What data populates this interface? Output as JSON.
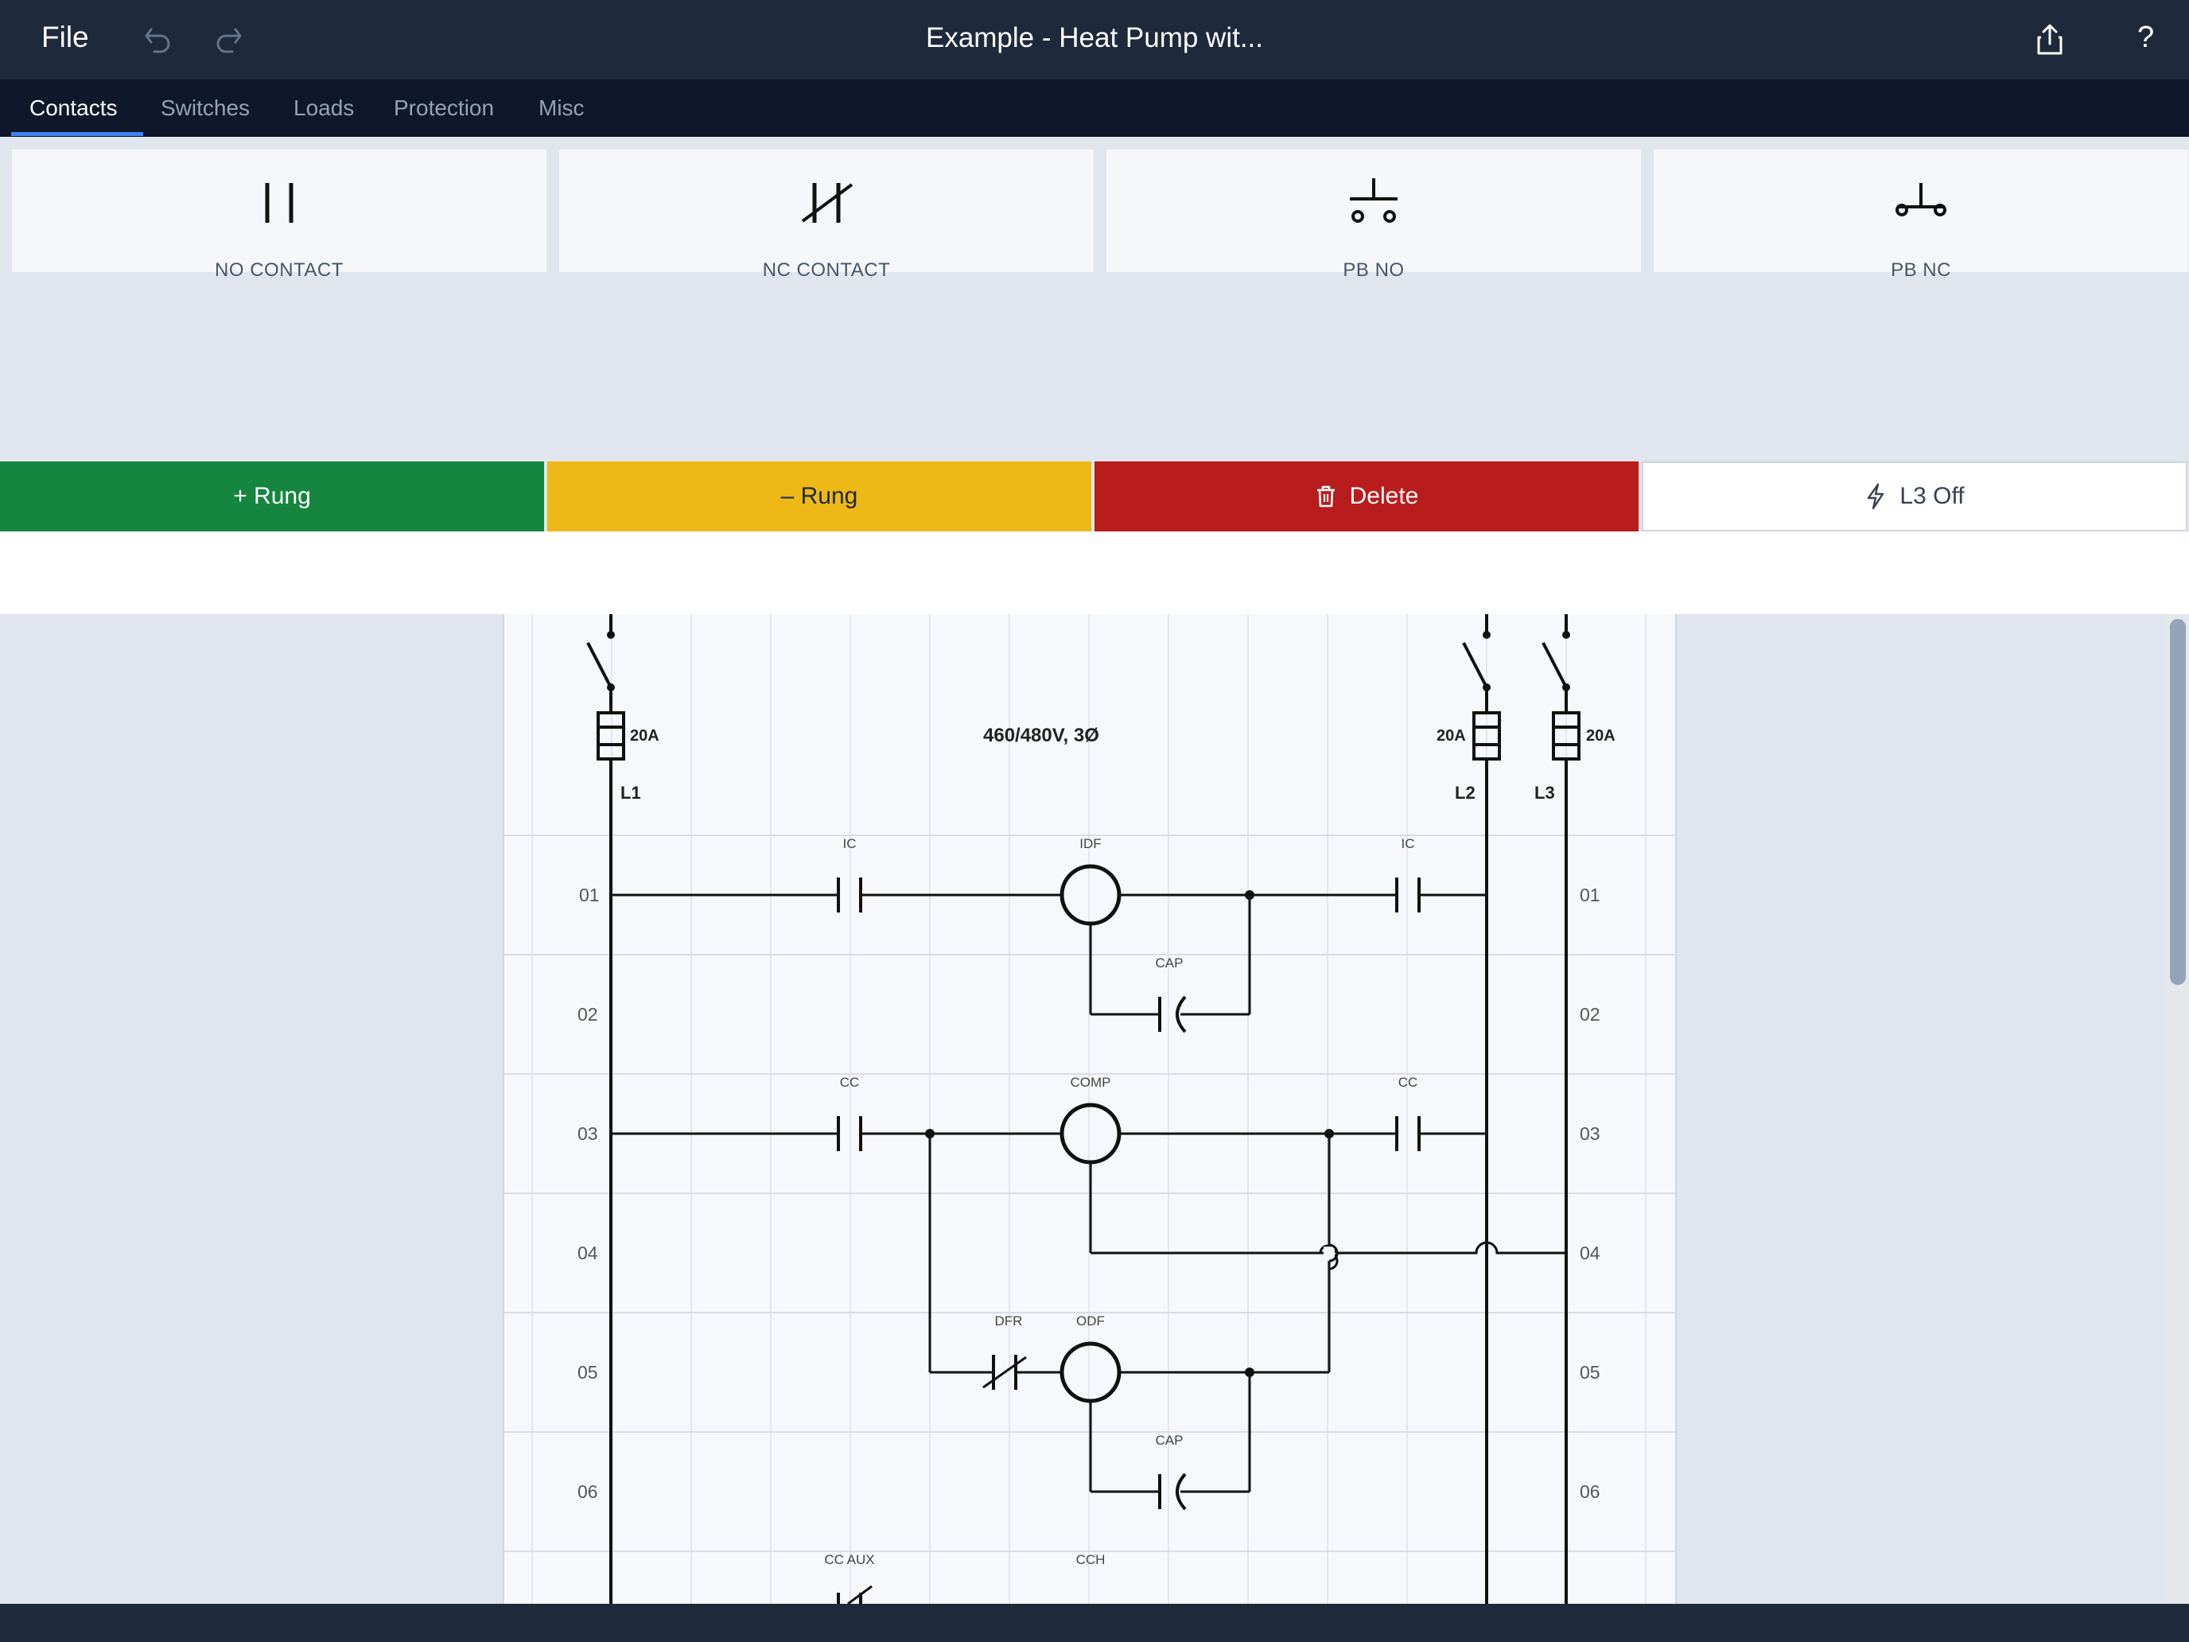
{
  "app": {
    "file_label": "File",
    "title": "Example - Heat Pump wit...",
    "icons": {
      "undo": "undo-icon",
      "redo": "redo-icon",
      "share": "share-icon"
    },
    "help_label": "?"
  },
  "tabs": [
    {
      "label": "Contacts",
      "active": true
    },
    {
      "label": "Switches"
    },
    {
      "label": "Loads"
    },
    {
      "label": "Protection"
    },
    {
      "label": "Misc"
    }
  ],
  "palette": {
    "items": [
      {
        "label": "NO CONTACT",
        "icon": "no-contact-icon"
      },
      {
        "label": "NC CONTACT",
        "icon": "nc-contact-icon"
      },
      {
        "label": "PB NO",
        "icon": "pb-no-icon"
      },
      {
        "label": "PB NC",
        "icon": "pb-nc-icon"
      }
    ]
  },
  "actions": {
    "add_rung": "+ Rung",
    "remove_rung": "– Rung",
    "delete": "Delete",
    "l3": "L3 Off",
    "colors": {
      "add": "#168540",
      "remove": "#eeb817",
      "delete": "#b91c1c"
    }
  },
  "diagram": {
    "voltage": "460/480V, 3Ø",
    "fuses": [
      "20A",
      "20A",
      "20A"
    ],
    "lines": [
      "L1",
      "L2",
      "L3"
    ],
    "rungs": [
      "01",
      "02",
      "03",
      "04",
      "05",
      "06"
    ],
    "components": {
      "ic_left": "IC",
      "idf": "IDF",
      "ic_right": "IC",
      "cap1": "CAP",
      "cc_left": "CC",
      "comp": "COMP",
      "cc_right": "CC",
      "dfr": "DFR",
      "odf": "ODF",
      "cap2": "CAP",
      "cc_aux": "CC AUX",
      "cch": "CCH"
    }
  }
}
